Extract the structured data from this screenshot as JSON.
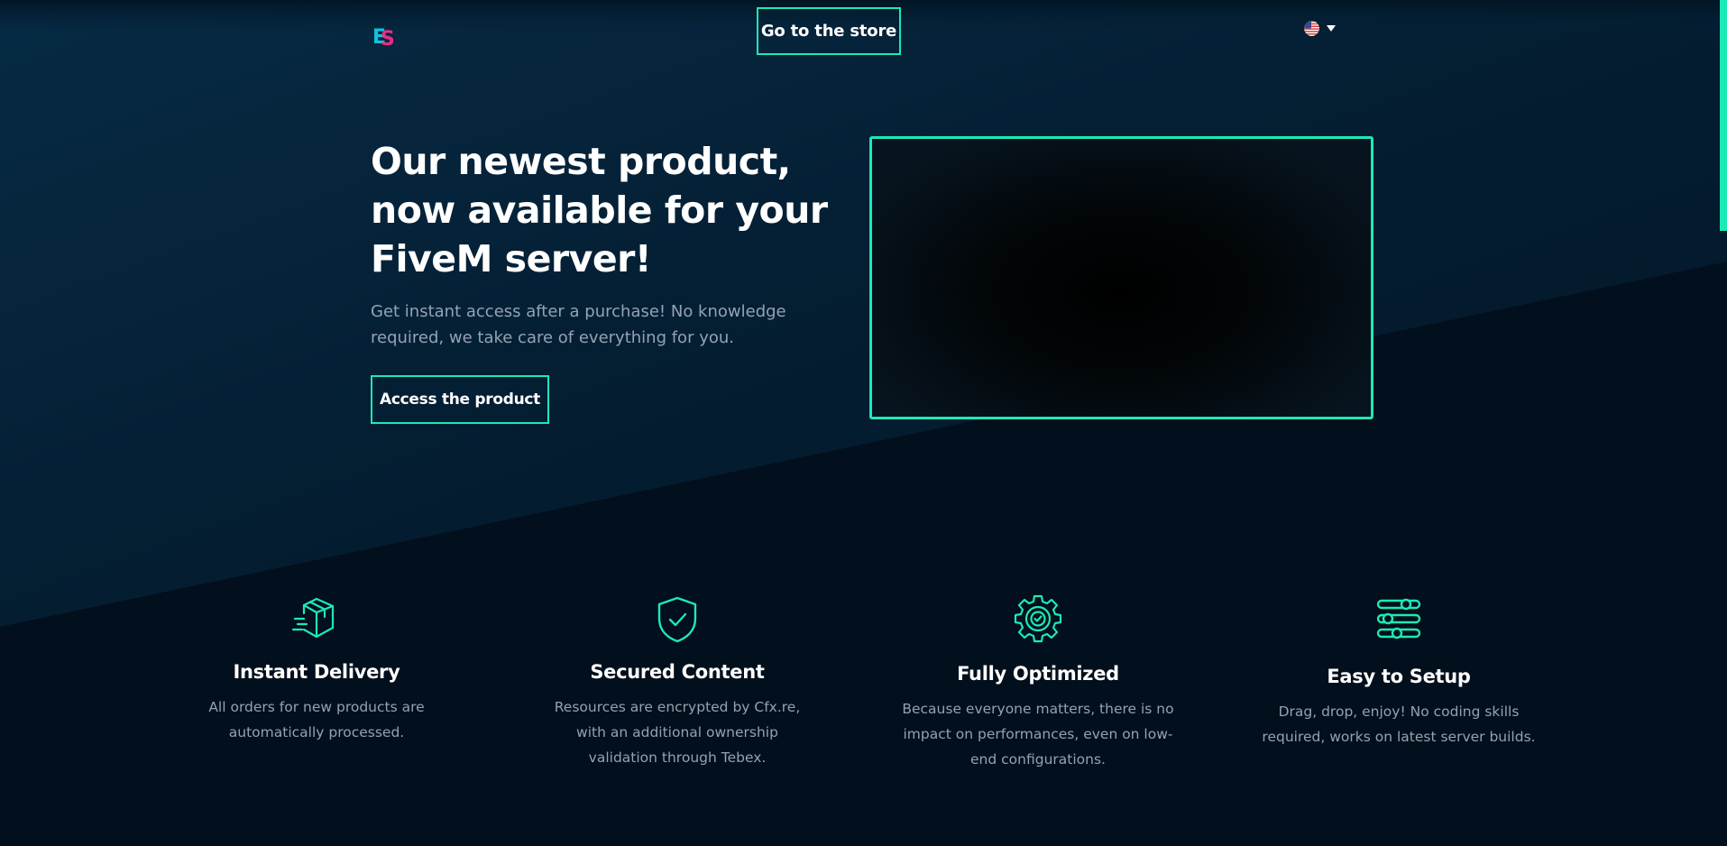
{
  "header": {
    "store_button": "Go to the store",
    "language": "English (US)"
  },
  "hero": {
    "title": "Our newest product, now available for your FiveM server!",
    "subtitle": "Get instant access after a purchase! No knowledge required, we take care of everything for you.",
    "cta": "Access the product"
  },
  "features": [
    {
      "icon": "box-delivery-icon",
      "title": "Instant Delivery",
      "description": "All orders for new products are automatically processed."
    },
    {
      "icon": "shield-check-icon",
      "title": "Secured Content",
      "description": "Resources are encrypted by Cfx.re, with an additional ownership validation through Tebex."
    },
    {
      "icon": "gear-check-icon",
      "title": "Fully Optimized",
      "description": "Because everyone matters, there is no impact on performances, even on low-end configurations."
    },
    {
      "icon": "sliders-icon",
      "title": "Easy to Setup",
      "description": "Drag, drop, enjoy! No coding skills required, works on latest server builds."
    }
  ],
  "colors": {
    "accent": "#1de9b6",
    "background_dark": "#020f1c",
    "background_light": "#062a44",
    "text_muted": "#93a3b3",
    "logo_cyan": "#0fc3e0",
    "logo_pink": "#ff2d8a"
  }
}
